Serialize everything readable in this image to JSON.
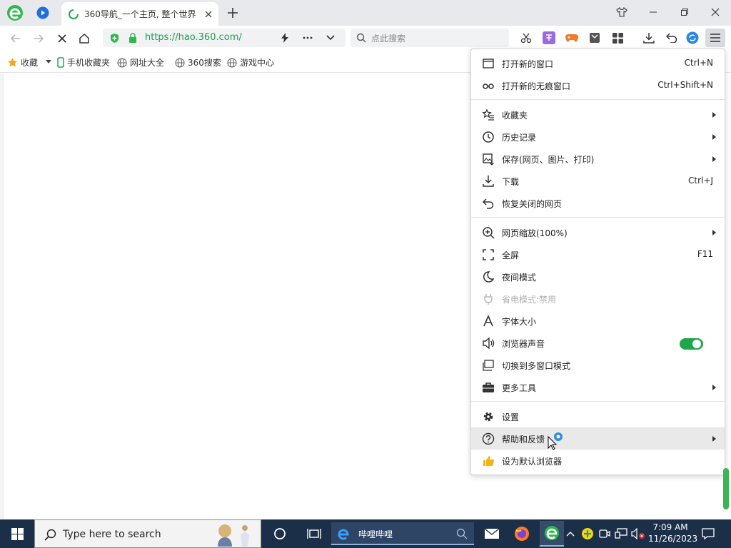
{
  "tab": {
    "title": "360导航_一个主页, 整个世界"
  },
  "address": {
    "url": "https://hao.360.com/"
  },
  "search": {
    "placeholder": "点此搜索"
  },
  "bookmarks": {
    "favorites": "收藏",
    "items": [
      "手机收藏夹",
      "网址大全",
      "360搜索",
      "游戏中心"
    ]
  },
  "menu": {
    "items": [
      {
        "label": "打开新的窗口",
        "shortcut": "Ctrl+N",
        "icon": "window-icon"
      },
      {
        "label": "打开新的无痕窗口",
        "shortcut": "Ctrl+Shift+N",
        "icon": "incognito-icon"
      },
      {
        "label": "收藏夹",
        "icon": "star-list-icon",
        "submenu": true
      },
      {
        "label": "历史记录",
        "icon": "clock-icon",
        "submenu": true
      },
      {
        "label": "保存(网页、图片、打印)",
        "icon": "save-image-icon",
        "submenu": true
      },
      {
        "label": "下载",
        "shortcut": "Ctrl+J",
        "icon": "download-icon"
      },
      {
        "label": "恢复关闭的网页",
        "icon": "undo-icon"
      },
      {
        "label": "网页缩放(100%)",
        "icon": "zoom-icon",
        "submenu": true
      },
      {
        "label": "全屏",
        "shortcut": "F11",
        "icon": "fullscreen-icon"
      },
      {
        "label": "夜间模式",
        "icon": "moon-icon"
      },
      {
        "label": "省电模式:禁用",
        "icon": "plug-icon",
        "disabled": true
      },
      {
        "label": "字体大小",
        "icon": "font-icon"
      },
      {
        "label": "浏览器声音",
        "icon": "speaker-icon",
        "toggle_on": true
      },
      {
        "label": "切换到多窗口模式",
        "icon": "multi-window-icon"
      },
      {
        "label": "更多工具",
        "icon": "toolbox-icon",
        "submenu": true
      },
      {
        "label": "设置",
        "icon": "gear-icon"
      },
      {
        "label": "帮助和反馈",
        "icon": "help-icon",
        "submenu": true,
        "hovered": true
      },
      {
        "label": "设为默认浏览器",
        "icon": "thumbs-up-icon"
      }
    ]
  },
  "taskbar": {
    "search_placeholder": "Type here to search",
    "app_label": "哔哩哔哩",
    "time": "7:09 AM",
    "date": "11/26/2023"
  },
  "colors": {
    "accent": "#1fa64a",
    "taskbar": "#1c2f48",
    "url_green": "#1a9f4c"
  }
}
